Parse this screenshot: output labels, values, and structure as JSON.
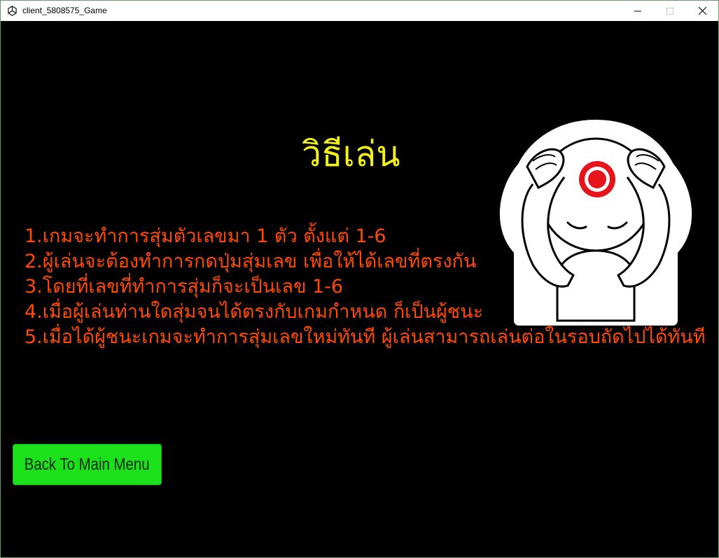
{
  "window": {
    "title": "client_5808575_Game"
  },
  "screen": {
    "heading": "วิธีเล่น",
    "rules": [
      "1.เกมจะทำการสุ่มตัวเลขมา 1 ตัว ตั้งแต่ 1-6",
      "2.ผู้เล่นจะต้องทำการกดปุ่มสุ่มเลข เพื่อให้ได้เลขที่ตรงกัน",
      "3.โดยที่เลขที่ทำการสุ่มก็จะเป็นเลข 1-6",
      "4.เมื่อผู้เล่นท่านใดสุ่มจนได้ตรงกับเกมกำหนด ก็เป็นผู้ชนะ",
      "5.เมื่อได้ผู้ชนะเกมจะทำการสุ่มเลขใหม่ทันที ผู้เล่นสามารถเล่นต่อในรอบถัดไปได้ทันที"
    ],
    "back_button_label": "Back To Main Menu"
  },
  "colors": {
    "background": "#000000",
    "heading": "#f2f21a",
    "rules_text": "#ff4a00",
    "button": "#1ae11a"
  },
  "icons": {
    "app": "unity-icon",
    "character": "headache-character-icon"
  }
}
